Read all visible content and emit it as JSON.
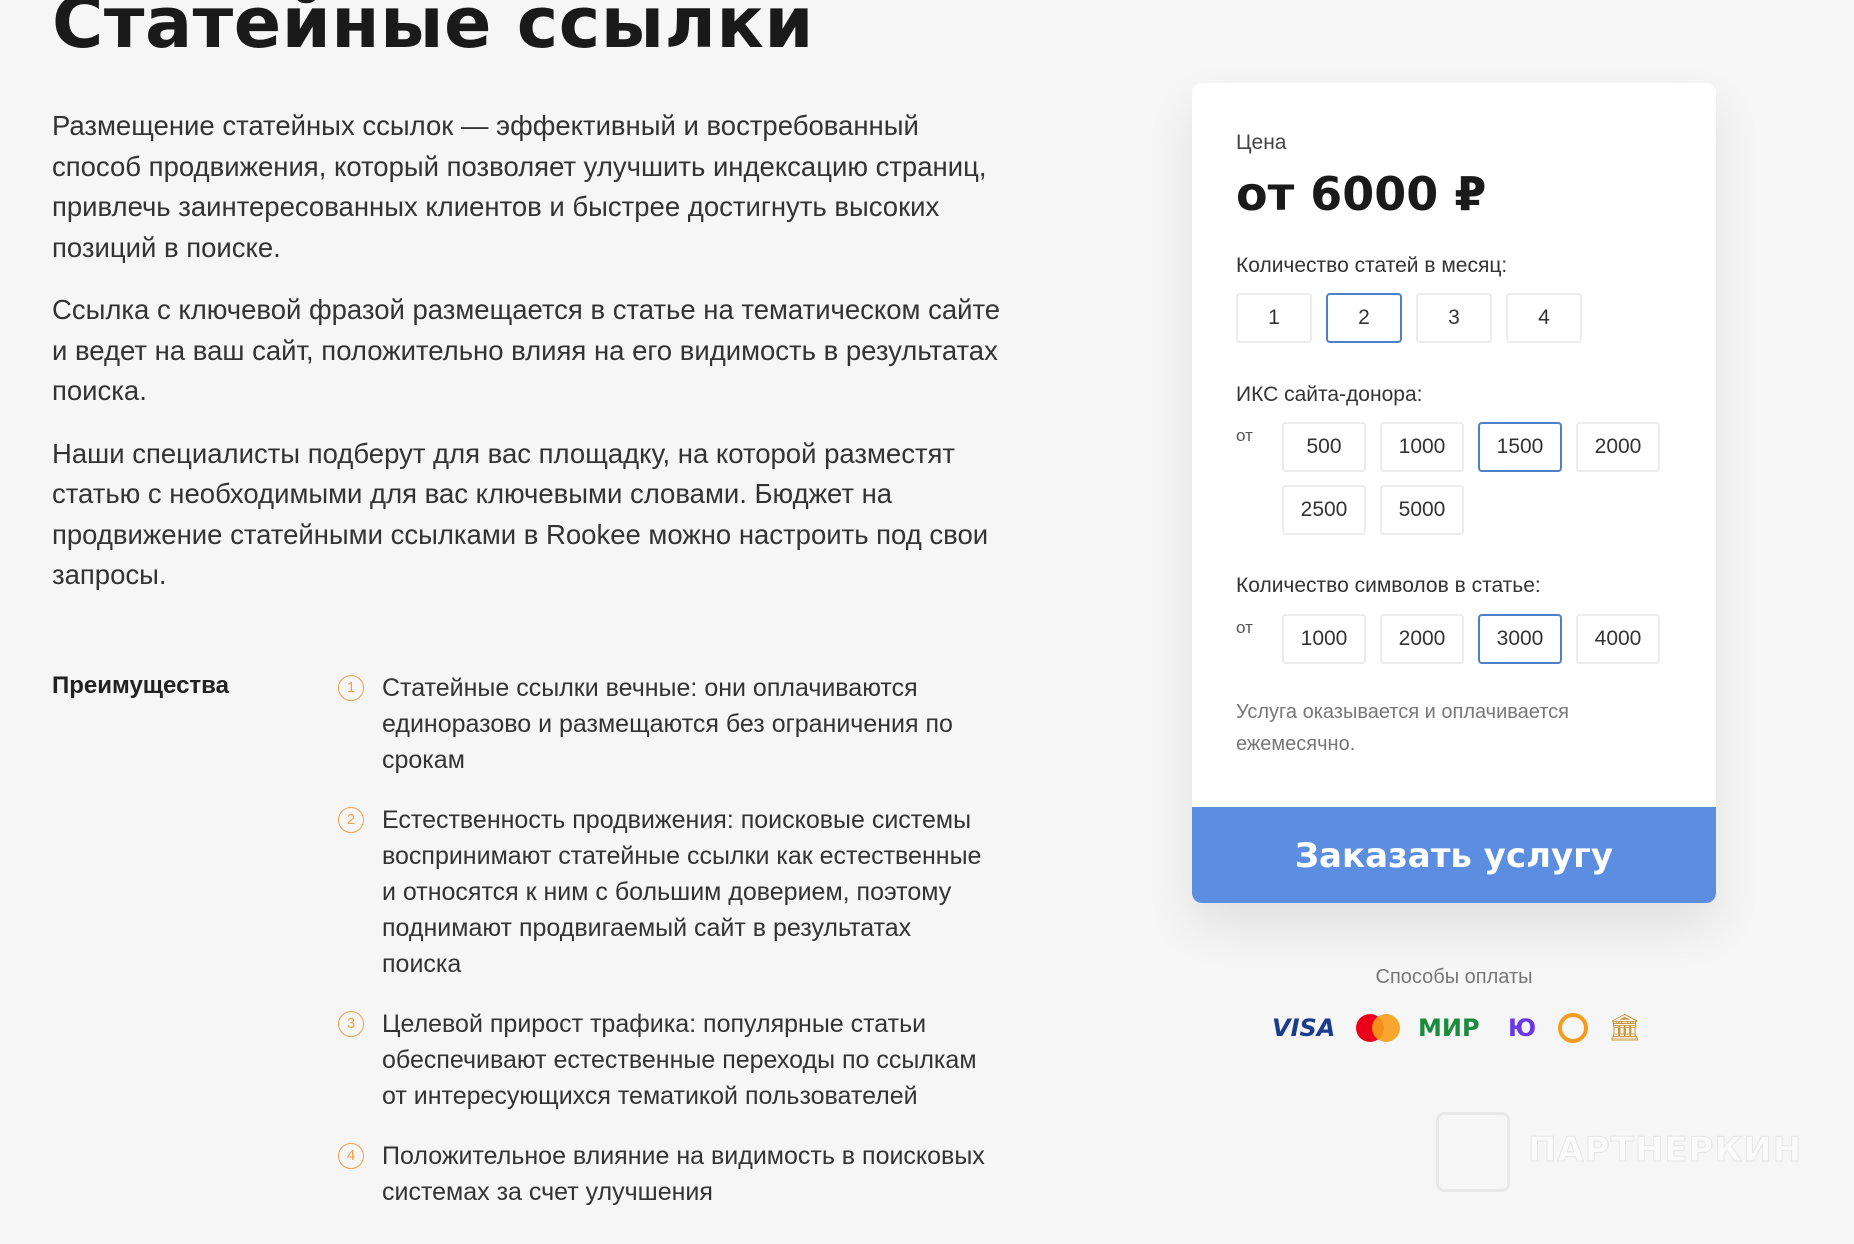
{
  "page": {
    "title": "Статейные ссылки",
    "intro": [
      "Размещение статейных ссылок — эффективный и востребованный способ продвижения, который позволяет улучшить индексацию страниц, привлечь заинтересованных клиентов и быстрее достигнуть высоких позиций в поиске.",
      "Ссылка с ключевой фразой размещается в статье на тематическом сайте и ведет на ваш сайт, положительно влияя на его видимость в результатах поиска.",
      "Наши специалисты подберут для вас площадку, на которой разместят статью с необходимыми для вас ключевыми словами. Бюджет на продвижение статейными ссылками в Rookee можно настроить под свои запросы."
    ]
  },
  "advantages": {
    "title": "Преимущества",
    "items": [
      {
        "num": "1",
        "text": "Статейные ссылки вечные: они оплачиваются единоразово и размещаются без ограничения по срокам"
      },
      {
        "num": "2",
        "text": "Естественность продвижения: поисковые системы воспринимают статейные ссылки как естественные и относятся к ним с большим доверием, поэтому поднимают продвигаемый сайт в результатах поиска"
      },
      {
        "num": "3",
        "text": "Целевой прирост трафика: популярные статьи обеспечивают естественные переходы по ссылкам от интересующихся тематикой пользователей"
      },
      {
        "num": "4",
        "text": "Положительное влияние на видимость в поисковых системах за счет улучшения"
      }
    ]
  },
  "card": {
    "price_label": "Цена",
    "price": "от 6000 ₽",
    "articles_label": "Количество статей в месяц:",
    "articles_options": [
      "1",
      "2",
      "3",
      "4"
    ],
    "articles_selected": "2",
    "iks_label": "ИКС сайта-донора:",
    "iks_from": "от",
    "iks_options": [
      "500",
      "1000",
      "1500",
      "2000",
      "2500",
      "5000"
    ],
    "iks_selected": "1500",
    "chars_label": "Количество символов в статье:",
    "chars_from": "от",
    "chars_options": [
      "1000",
      "2000",
      "3000",
      "4000"
    ],
    "chars_selected": "3000",
    "note": "Услуга оказывается и оплачивается ежемесячно.",
    "order_button": "Заказать услугу"
  },
  "payment": {
    "title": "Способы оплаты",
    "visa": "VISA",
    "mir": "МИР",
    "yumoney": "Ю",
    "icons": [
      "visa-icon",
      "mastercard-icon",
      "mir-icon",
      "yumoney-icon",
      "qiwi-icon",
      "bank-icon"
    ],
    "colors": {
      "visa": "#1a3c8c",
      "mc_red": "#eb001b",
      "mc_yellow": "#f79e1b",
      "mir": "#1c8b3f",
      "yumoney": "#6b35e8",
      "qiwi": "#f89c1c",
      "bank": "#c89a3c"
    }
  },
  "watermark": {
    "text": "ПАРТНЕРКИН"
  },
  "colors": {
    "accent": "#5b8ee0",
    "selected_border": "#4f7fc9",
    "number_accent": "#f0a24a"
  }
}
